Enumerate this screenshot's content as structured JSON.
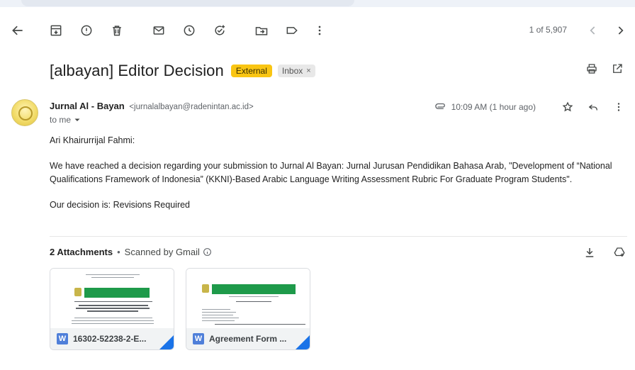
{
  "toolbar": {
    "pager_text": "1 of 5,907"
  },
  "message": {
    "subject": "[albayan] Editor Decision",
    "labels": {
      "external": "External",
      "inbox": "Inbox",
      "inbox_remove": "×"
    },
    "sender_name": "Jurnal Al - Bayan",
    "sender_email": "<jurnalalbayan@radenintan.ac.id>",
    "to_text": "to me",
    "time": "10:09 AM (1 hour ago)",
    "body": {
      "greeting": "Ari Khairurrijal Fahmi:",
      "paragraph": "We have reached a decision regarding your submission to Jurnal Al Bayan: Jurnal Jurusan Pendidikan Bahasa Arab, \"Development of “National Qualifications Framework of Indonesia” (KKNI)-Based Arabic Language Writing Assessment Rubric For Graduate Program Students\".",
      "decision": "Our decision is: Revisions Required"
    }
  },
  "attachments": {
    "count_label": "2 Attachments",
    "separator": "•",
    "scan_label": "Scanned by Gmail",
    "items": [
      {
        "name": "16302-52238-2-E...",
        "type_icon": "W"
      },
      {
        "name": "Agreement Form ...",
        "type_icon": "W"
      }
    ]
  },
  "colors": {
    "external_badge": "#f9c513",
    "word_icon": "#4f7fd9",
    "corner_accent": "#1a73e8"
  }
}
